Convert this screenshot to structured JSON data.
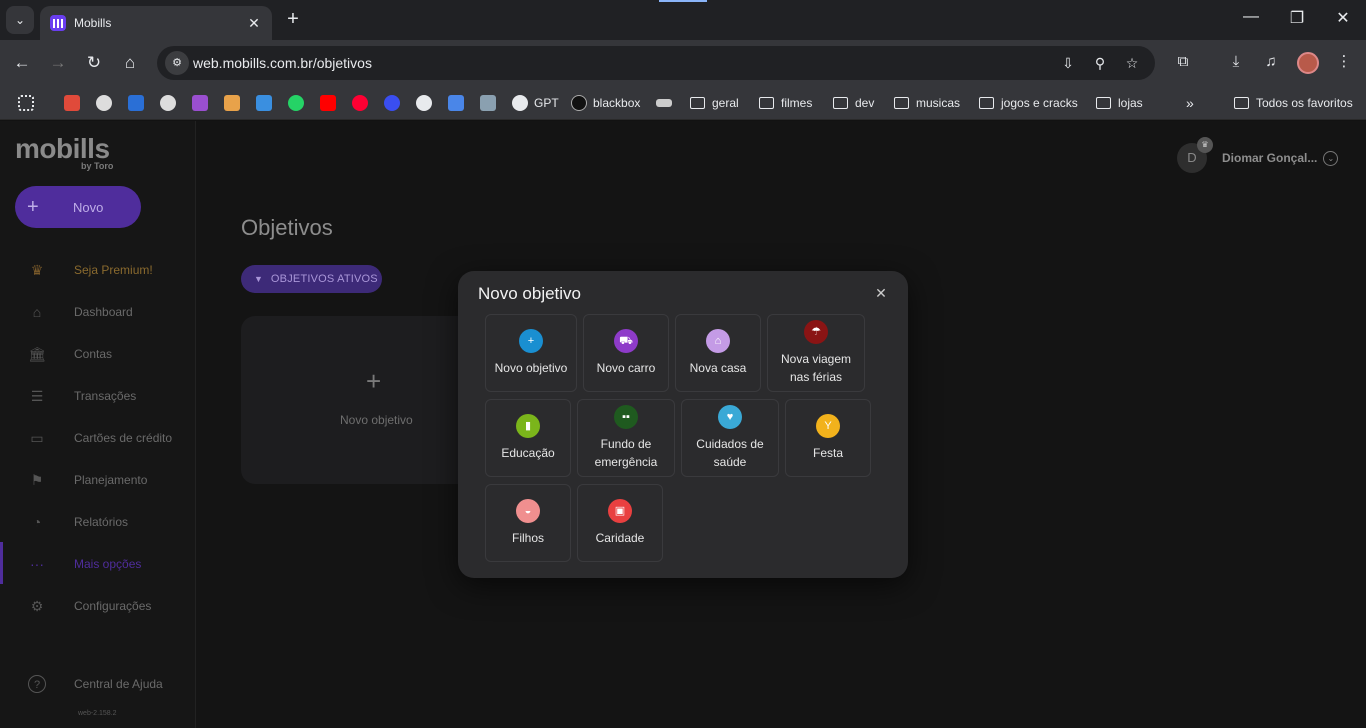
{
  "browser": {
    "tab_title": "Mobills",
    "url": "web.mobills.com.br/objetivos",
    "bookmarks": [
      {
        "label": "GPT"
      },
      {
        "label": "blackbox"
      },
      {
        "label": "geral"
      },
      {
        "label": "filmes"
      },
      {
        "label": "dev"
      },
      {
        "label": "musicas"
      },
      {
        "label": "jogos e cracks"
      },
      {
        "label": "lojas"
      }
    ],
    "all_bookmarks": "Todos os favoritos"
  },
  "sidebar": {
    "logo": "mobills",
    "logo_sub": "by Toro",
    "new_button": "Novo",
    "items": [
      {
        "label": "Seja Premium!",
        "icon": "crown-icon"
      },
      {
        "label": "Dashboard",
        "icon": "home-icon"
      },
      {
        "label": "Contas",
        "icon": "bank-icon"
      },
      {
        "label": "Transações",
        "icon": "list-icon"
      },
      {
        "label": "Cartões de crédito",
        "icon": "wallet-icon"
      },
      {
        "label": "Planejamento",
        "icon": "flag-icon"
      },
      {
        "label": "Relatórios",
        "icon": "pie-icon"
      },
      {
        "label": "Mais opções",
        "icon": "more-icon"
      },
      {
        "label": "Configurações",
        "icon": "gear-icon"
      },
      {
        "label": "Central de Ajuda",
        "icon": "help-icon"
      }
    ],
    "version": "web-2.158.2"
  },
  "header": {
    "avatar_initial": "D",
    "user_name": "Diomar Gonçal..."
  },
  "main": {
    "title": "Objetivos",
    "filter_label": "OBJETIVOS ATIVOS",
    "card_label": "Novo objetivo"
  },
  "modal": {
    "title": "Novo objetivo",
    "options": [
      {
        "label": "Novo objetivo",
        "color": "#1a8fd1",
        "icon": "plus-icon"
      },
      {
        "label": "Novo carro",
        "color": "#8e3bc9",
        "icon": "car-icon"
      },
      {
        "label": "Nova casa",
        "color": "#c49be6",
        "icon": "house-icon"
      },
      {
        "label": "Nova viagem nas férias",
        "color": "#8a1414",
        "icon": "beach-icon"
      },
      {
        "label": "Educação",
        "color": "#7bb51b",
        "icon": "book-icon"
      },
      {
        "label": "Fundo de emergência",
        "color": "#1f5a1f",
        "icon": "money-icon"
      },
      {
        "label": "Cuidados de saúde",
        "color": "#3aa9d6",
        "icon": "health-icon"
      },
      {
        "label": "Festa",
        "color": "#f2b21c",
        "icon": "cocktail-icon"
      },
      {
        "label": "Filhos",
        "color": "#f08f8f",
        "icon": "stroller-icon"
      },
      {
        "label": "Caridade",
        "color": "#e94040",
        "icon": "gift-icon"
      }
    ]
  }
}
